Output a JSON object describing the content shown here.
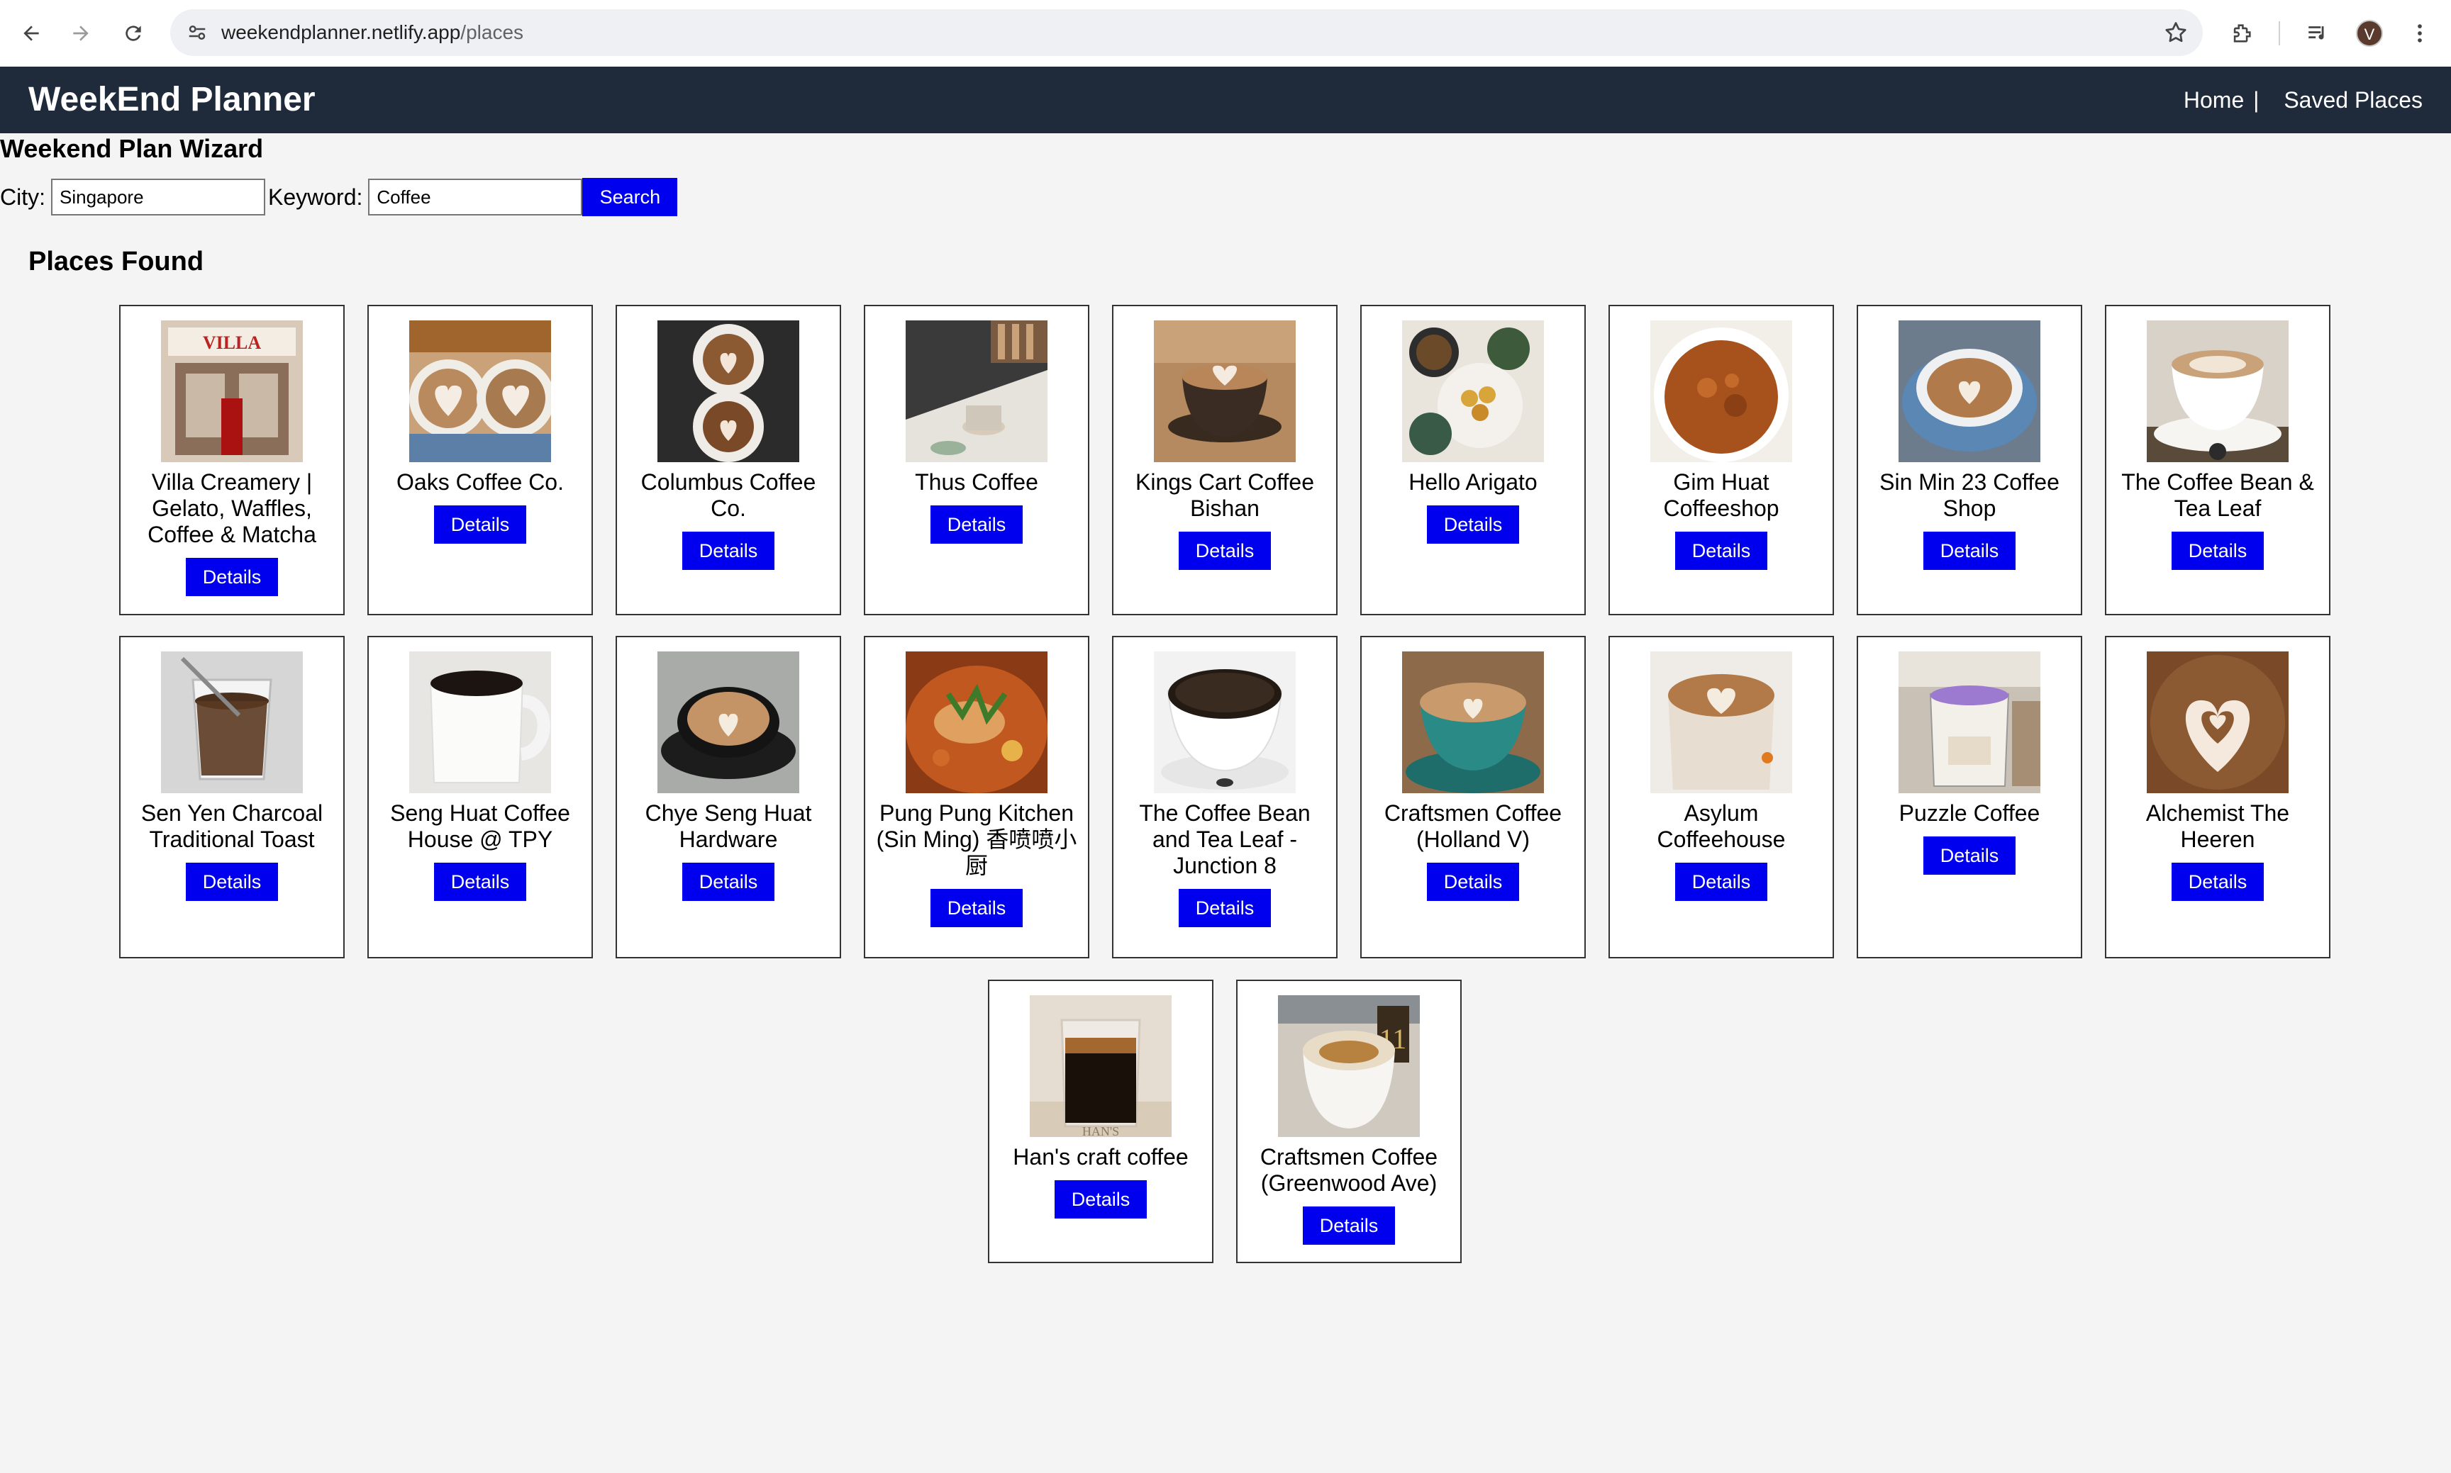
{
  "browser": {
    "url_host": "weekendplanner.netlify.app",
    "url_path": "/places",
    "profile_initial": "V"
  },
  "header": {
    "title": "WeekEnd Planner",
    "nav": [
      {
        "label": "Home",
        "separator": "|"
      },
      {
        "label": "Saved Places"
      }
    ]
  },
  "wizard": {
    "title": "Weekend Plan Wizard",
    "city_label": "City:",
    "city_value": "Singapore",
    "keyword_label": "Keyword:",
    "keyword_value": "Coffee",
    "search_label": "Search"
  },
  "places_title": "Places Found",
  "details_label": "Details",
  "places": [
    {
      "name": "Villa Creamery | Gelato, Waffles, Coffee & Matcha",
      "photo": "storefront"
    },
    {
      "name": "Oaks Coffee Co.",
      "photo": "latte-pair"
    },
    {
      "name": "Columbus Coffee Co.",
      "photo": "latte-topdown"
    },
    {
      "name": "Thus Coffee",
      "photo": "cafe-interior"
    },
    {
      "name": "Kings Cart Coffee Bishan",
      "photo": "latte-cup"
    },
    {
      "name": "Hello Arigato",
      "photo": "food-platter"
    },
    {
      "name": "Gim Huat Coffeeshop",
      "photo": "curry-bowl"
    },
    {
      "name": "Sin Min 23 Coffee Shop",
      "photo": "latte-blue-cup"
    },
    {
      "name": "The Coffee Bean & Tea Leaf",
      "photo": "cappuccino-white"
    },
    {
      "name": "Sen Yen Charcoal Traditional Toast",
      "photo": "kopi-glass"
    },
    {
      "name": "Seng Huat Coffee House @ TPY",
      "photo": "black-coffee-mug"
    },
    {
      "name": "Chye Seng Huat Hardware",
      "photo": "latte-black-cup"
    },
    {
      "name": "Pung Pung Kitchen (Sin Ming) 香喷喷小厨",
      "photo": "fish-curry"
    },
    {
      "name": "The Coffee Bean and Tea Leaf - Junction 8",
      "photo": "black-coffee-cup"
    },
    {
      "name": "Craftsmen Coffee (Holland V)",
      "photo": "latte-teal-cup"
    },
    {
      "name": "Asylum Coffeehouse",
      "photo": "latte-ceramic"
    },
    {
      "name": "Puzzle Coffee",
      "photo": "purple-drink"
    },
    {
      "name": "Alchemist The Heeren",
      "photo": "latte-art-closeup"
    },
    {
      "name": "Han's craft coffee",
      "photo": "espresso-glass"
    },
    {
      "name": "Craftsmen Coffee (Greenwood Ave)",
      "photo": "cappuccino-number"
    }
  ]
}
